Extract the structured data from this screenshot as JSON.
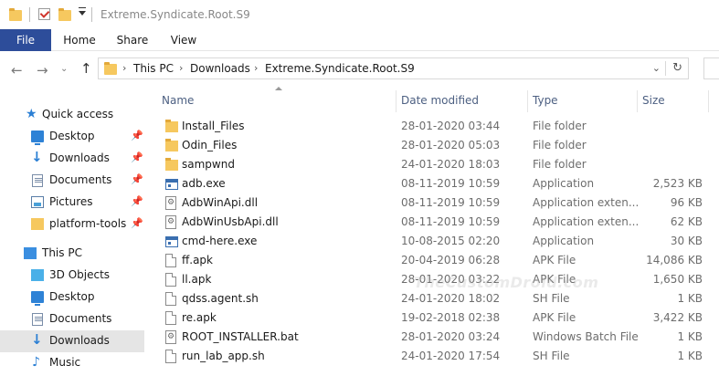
{
  "window": {
    "title": "Extreme.Syndicate.Root.S9"
  },
  "ribbon": {
    "tabs": [
      "File",
      "Home",
      "Share",
      "View"
    ]
  },
  "address": {
    "crumbs": [
      "This PC",
      "Downloads",
      "Extreme.Syndicate.Root.S9"
    ]
  },
  "columns": {
    "name": "Name",
    "date": "Date modified",
    "type": "Type",
    "size": "Size"
  },
  "sidebar": {
    "items": [
      {
        "label": "Quick access",
        "icon": "star-icon",
        "pinned": false
      },
      {
        "label": "Desktop",
        "icon": "desktop-icon",
        "pinned": true
      },
      {
        "label": "Downloads",
        "icon": "download-icon",
        "pinned": true
      },
      {
        "label": "Documents",
        "icon": "documents-icon",
        "pinned": true
      },
      {
        "label": "Pictures",
        "icon": "pictures-icon",
        "pinned": true
      },
      {
        "label": "platform-tools",
        "icon": "folder-icon",
        "pinned": true
      },
      {
        "label": "This PC",
        "icon": "computer-icon",
        "pinned": false
      },
      {
        "label": "3D Objects",
        "icon": "cube-icon",
        "pinned": false
      },
      {
        "label": "Desktop",
        "icon": "desktop-icon",
        "pinned": false
      },
      {
        "label": "Documents",
        "icon": "documents-icon",
        "pinned": false
      },
      {
        "label": "Downloads",
        "icon": "download-icon",
        "pinned": false
      },
      {
        "label": "Music",
        "icon": "music-icon",
        "pinned": false
      }
    ]
  },
  "files": [
    {
      "name": "Install_Files",
      "date": "28-01-2020 03:44",
      "type": "File folder",
      "size": "",
      "icon": "folder"
    },
    {
      "name": "Odin_Files",
      "date": "28-01-2020 05:03",
      "type": "File folder",
      "size": "",
      "icon": "folder"
    },
    {
      "name": "sampwnd",
      "date": "24-01-2020 18:03",
      "type": "File folder",
      "size": "",
      "icon": "folder"
    },
    {
      "name": "adb.exe",
      "date": "08-11-2019 10:59",
      "type": "Application",
      "size": "2,523 KB",
      "icon": "exe"
    },
    {
      "name": "AdbWinApi.dll",
      "date": "08-11-2019 10:59",
      "type": "Application exten...",
      "size": "96 KB",
      "icon": "dll"
    },
    {
      "name": "AdbWinUsbApi.dll",
      "date": "08-11-2019 10:59",
      "type": "Application exten...",
      "size": "62 KB",
      "icon": "dll"
    },
    {
      "name": "cmd-here.exe",
      "date": "10-08-2015 02:20",
      "type": "Application",
      "size": "30 KB",
      "icon": "exe"
    },
    {
      "name": "ff.apk",
      "date": "20-04-2019 06:28",
      "type": "APK File",
      "size": "14,086 KB",
      "icon": "file"
    },
    {
      "name": "ll.apk",
      "date": "28-01-2020 03:22",
      "type": "APK File",
      "size": "1,650 KB",
      "icon": "file"
    },
    {
      "name": "qdss.agent.sh",
      "date": "24-01-2020 18:02",
      "type": "SH File",
      "size": "1 KB",
      "icon": "file"
    },
    {
      "name": "re.apk",
      "date": "19-02-2018 02:38",
      "type": "APK File",
      "size": "3,422 KB",
      "icon": "file"
    },
    {
      "name": "ROOT_INSTALLER.bat",
      "date": "28-01-2020 03:24",
      "type": "Windows Batch File",
      "size": "1 KB",
      "icon": "bat"
    },
    {
      "name": "run_lab_app.sh",
      "date": "24-01-2020 17:54",
      "type": "SH File",
      "size": "1 KB",
      "icon": "file"
    }
  ],
  "watermark": "TheCustomDroid.com",
  "colors": {
    "file_tab": "#2d4d9a",
    "selected_nav": "#e5e5e5",
    "header_text": "#4d6082",
    "folder": "#f6c85f"
  }
}
